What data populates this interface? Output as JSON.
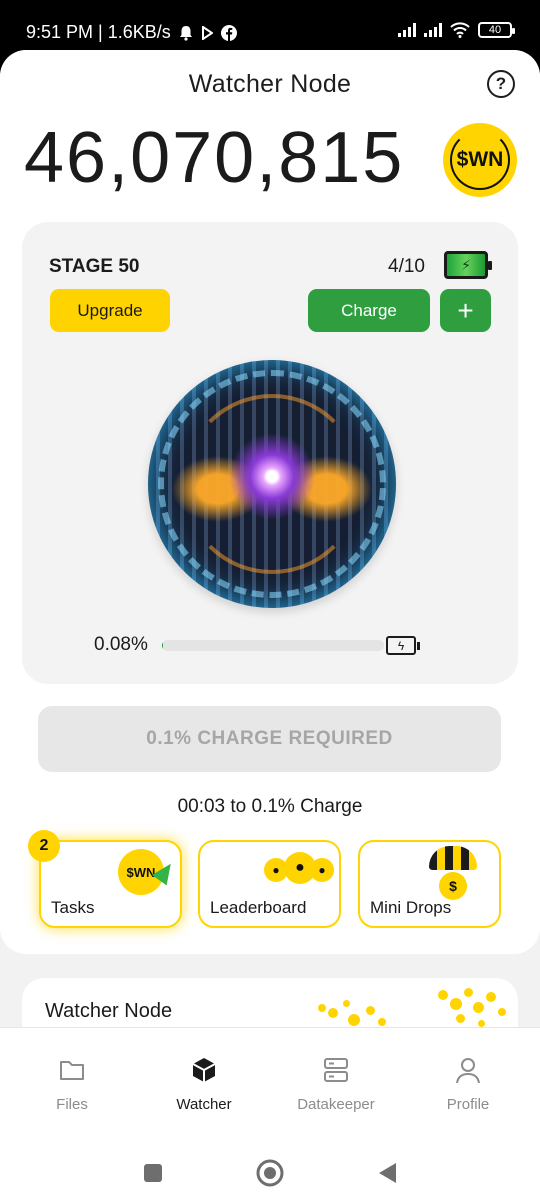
{
  "status_bar": {
    "time_speed": "9:51 PM | 1.6KB/s",
    "battery": "40"
  },
  "header": {
    "title": "Watcher Node",
    "help_icon": "?"
  },
  "balance": {
    "amount": "46,070,815",
    "coin_label": "$WN"
  },
  "stage_panel": {
    "stage_label": "STAGE 50",
    "charges": "4/10",
    "upgrade_label": "Upgrade",
    "charge_label": "Charge",
    "plus_label": "+",
    "progress_text": "0.08%",
    "progress_value": 0.0008
  },
  "charge_required_label": "0.1% CHARGE REQUIRED",
  "timer_text": "00:03 to 0.1% Charge",
  "tiles": {
    "tasks": {
      "label": "Tasks",
      "badge": "2",
      "coin_label": "$WN"
    },
    "leaderboard": {
      "label": "Leaderboard"
    },
    "mini_drops": {
      "label": "Mini Drops",
      "coin_label": "$"
    }
  },
  "lower_card": {
    "title": "Watcher Node"
  },
  "bottom_nav": {
    "items": [
      {
        "label": "Files",
        "icon": "folder-icon"
      },
      {
        "label": "Watcher",
        "icon": "cube-icon"
      },
      {
        "label": "Datakeeper",
        "icon": "server-icon"
      },
      {
        "label": "Profile",
        "icon": "user-icon"
      }
    ],
    "active": "Watcher"
  },
  "colors": {
    "accent_yellow": "#ffd400",
    "accent_green": "#2e9e3e",
    "disabled_gray": "#e7e7e7"
  }
}
